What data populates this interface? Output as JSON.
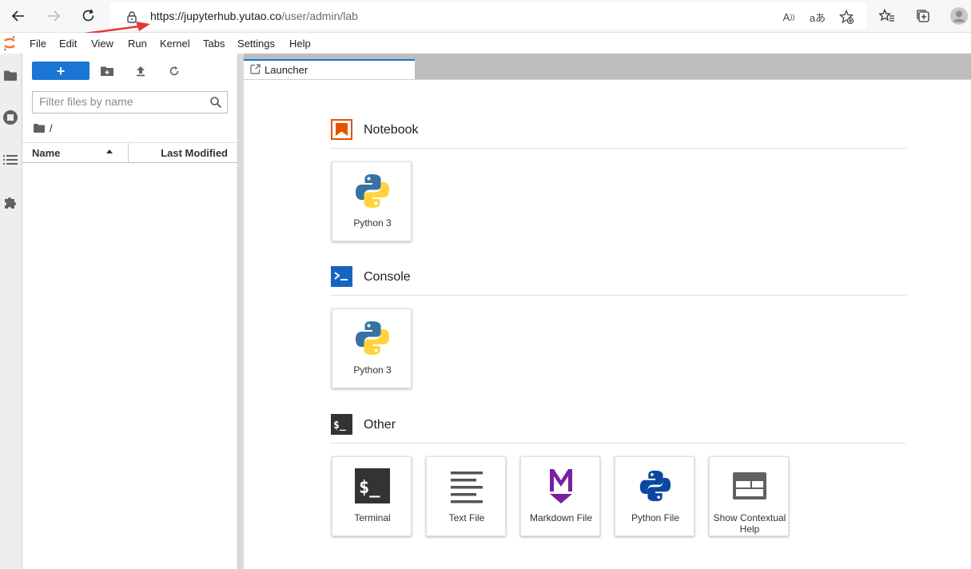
{
  "browser": {
    "url_host": "https://jupyterhub.yutao.co",
    "url_path": "/user/admin/lab"
  },
  "menubar": {
    "items": [
      "File",
      "Edit",
      "View",
      "Run",
      "Kernel",
      "Tabs",
      "Settings",
      "Help"
    ]
  },
  "filebrowser": {
    "new_label": "+",
    "filter_placeholder": "Filter files by name",
    "breadcrumb": "/",
    "col_name": "Name",
    "col_modified": "Last Modified"
  },
  "tabs": [
    {
      "label": "Launcher"
    }
  ],
  "launcher": {
    "sections": [
      {
        "title": "Notebook",
        "cards": [
          {
            "label": "Python 3"
          }
        ]
      },
      {
        "title": "Console",
        "cards": [
          {
            "label": "Python 3"
          }
        ]
      },
      {
        "title": "Other",
        "cards": [
          {
            "label": "Terminal"
          },
          {
            "label": "Text File"
          },
          {
            "label": "Markdown File"
          },
          {
            "label": "Python File"
          },
          {
            "label": "Show Contextual Help"
          }
        ]
      }
    ],
    "console_icon_text": ">_",
    "other_icon_text": "$_"
  },
  "colors": {
    "accent": "#1976d2",
    "notebook_orange": "#e65100",
    "markdown_purple": "#7b1fa2",
    "annotation_arrow": "#e53935"
  },
  "icons": [
    "back-arrow-icon",
    "forward-arrow-icon",
    "refresh-icon",
    "lock-icon",
    "read-aloud-icon",
    "translate-icon",
    "favorite-add-icon",
    "favorites-icon",
    "collections-icon",
    "profile-icon",
    "jupyter-logo",
    "folder-icon",
    "running-icon",
    "toc-icon",
    "extension-icon",
    "new-folder-icon",
    "upload-icon",
    "refresh-files-icon",
    "search-icon"
  ]
}
